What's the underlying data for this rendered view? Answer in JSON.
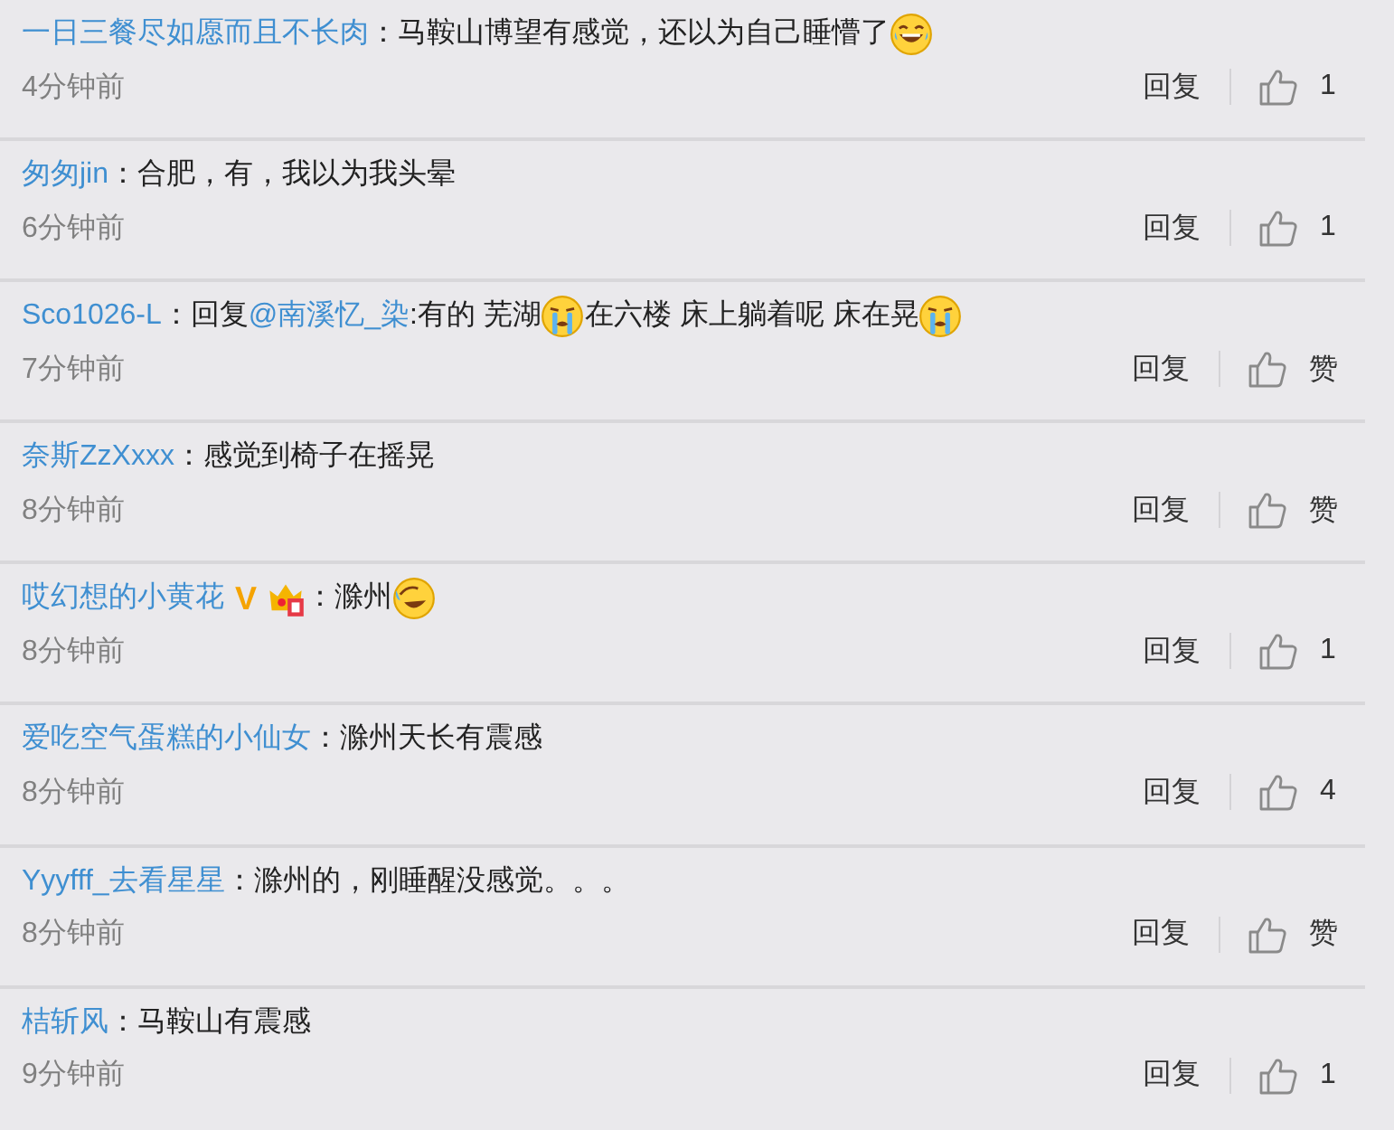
{
  "comments": [
    {
      "user": "一日三餐尽如愿而且不长肉",
      "separator": "：",
      "parts": [
        {
          "kind": "text",
          "text": "马鞍山博望有感觉，还以为自己睡懵了"
        },
        {
          "kind": "laugh-emoji"
        }
      ],
      "time": "4分钟前",
      "reply": "回复",
      "likes": "1"
    },
    {
      "user": "匆匆jin",
      "separator": "：",
      "parts": [
        {
          "kind": "text",
          "text": "合肥，有，我以为我头晕"
        }
      ],
      "time": "6分钟前",
      "reply": "回复",
      "likes": "1"
    },
    {
      "user": "Sco1026-L",
      "separator": "：",
      "parts": [
        {
          "kind": "text",
          "text": "回复"
        },
        {
          "kind": "mention",
          "text": "@南溪忆_染"
        },
        {
          "kind": "text",
          "text": ":有的 芜湖"
        },
        {
          "kind": "cry-emoji"
        },
        {
          "kind": "text",
          "text": "在六楼 床上躺着呢 床在晃"
        },
        {
          "kind": "cry-emoji"
        }
      ],
      "time": "7分钟前",
      "reply": "回复",
      "likes": "赞"
    },
    {
      "user": "奈斯ZzXxxx",
      "separator": "：",
      "parts": [
        {
          "kind": "text",
          "text": "感觉到椅子在摇晃"
        }
      ],
      "time": "8分钟前",
      "reply": "回复",
      "likes": "赞"
    },
    {
      "user": "哎幻想的小黄花",
      "badges": [
        {
          "kind": "verified",
          "text": "V"
        },
        {
          "kind": "crown"
        }
      ],
      "separator": "：",
      "parts": [
        {
          "kind": "text",
          "text": "滁州"
        },
        {
          "kind": "roll-emoji"
        }
      ],
      "time": "8分钟前",
      "reply": "回复",
      "likes": "1"
    },
    {
      "user": "爱吃空气蛋糕的小仙女",
      "separator": "：",
      "parts": [
        {
          "kind": "text",
          "text": "滁州天长有震感"
        }
      ],
      "time": "8分钟前",
      "reply": "回复",
      "likes": "4"
    },
    {
      "user": "Yyyfff_去看星星",
      "separator": "：",
      "parts": [
        {
          "kind": "text",
          "text": "滁州的，刚睡醒没感觉。。。"
        }
      ],
      "time": "8分钟前",
      "reply": "回复",
      "likes": "赞"
    },
    {
      "user": "桔斩风",
      "separator": "：",
      "parts": [
        {
          "kind": "text",
          "text": "马鞍山有震感"
        }
      ],
      "time": "9分钟前",
      "reply": "回复",
      "likes": "1"
    }
  ]
}
